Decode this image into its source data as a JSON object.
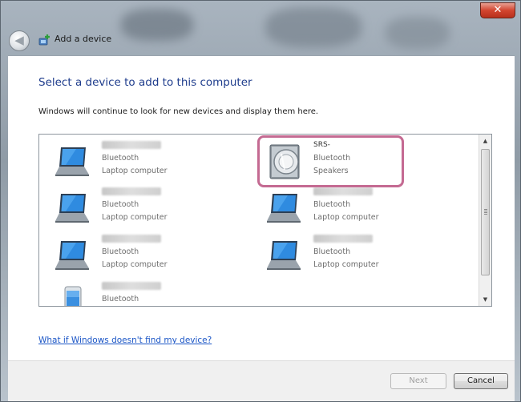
{
  "window": {
    "title": "Add a device",
    "close_glyph": "✕",
    "back_glyph": "◀"
  },
  "page": {
    "heading": "Select a device to add to this computer",
    "subtext": "Windows will continue to look for new devices and display them here."
  },
  "devices": [
    {
      "name": "",
      "type": "Bluetooth",
      "category": "Laptop computer",
      "icon": "laptop-icon"
    },
    {
      "name": "SRS-",
      "type": "Bluetooth",
      "category": "Speakers",
      "icon": "speaker-icon",
      "highlighted": true
    },
    {
      "name": "",
      "type": "Bluetooth",
      "category": "Laptop computer",
      "icon": "laptop-icon"
    },
    {
      "name": "",
      "type": "Bluetooth",
      "category": "Laptop computer",
      "icon": "laptop-icon"
    },
    {
      "name": "",
      "type": "Bluetooth",
      "category": "Laptop computer",
      "icon": "laptop-icon"
    },
    {
      "name": "",
      "type": "Bluetooth",
      "category": "Laptop computer",
      "icon": "laptop-icon"
    },
    {
      "name": "",
      "type": "Bluetooth",
      "category": "",
      "icon": "phone-icon"
    }
  ],
  "help_link": "What if Windows doesn't find my device?",
  "buttons": {
    "next": "Next",
    "cancel": "Cancel"
  },
  "colors": {
    "heading": "#1e3c8c",
    "link": "#1a55c6",
    "highlight": "#c46a92",
    "close": "#d2452f"
  }
}
